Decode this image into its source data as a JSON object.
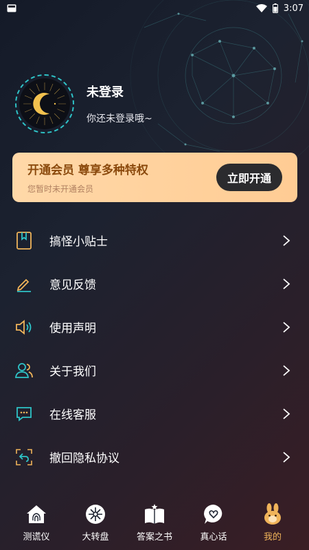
{
  "status_bar": {
    "time": "3:07"
  },
  "profile": {
    "name": "未登录",
    "subtitle": "你还未登录哦~"
  },
  "vip": {
    "title": "开通会员 尊享多种特权",
    "subtitle": "您暂时未开通会员",
    "button": "立即开通"
  },
  "menu": [
    {
      "label": "搞怪小贴士",
      "icon": "bookmark-icon"
    },
    {
      "label": "意见反馈",
      "icon": "pencil-icon"
    },
    {
      "label": "使用声明",
      "icon": "speaker-icon"
    },
    {
      "label": "关于我们",
      "icon": "users-icon"
    },
    {
      "label": "在线客服",
      "icon": "chat-icon"
    },
    {
      "label": "撤回隐私协议",
      "icon": "undo-icon"
    }
  ],
  "tabs": [
    {
      "label": "测谎仪",
      "icon": "fingerprint-house-icon",
      "active": false
    },
    {
      "label": "大转盘",
      "icon": "wheel-icon",
      "active": false
    },
    {
      "label": "答案之书",
      "icon": "book-icon",
      "active": false
    },
    {
      "label": "真心话",
      "icon": "heart-bubble-icon",
      "active": false
    },
    {
      "label": "我的",
      "icon": "bunny-icon",
      "active": true
    }
  ],
  "colors": {
    "accent": "#2ec4c8",
    "vip_bg": "#ffd8a8",
    "vip_text": "#8b4a0d",
    "active_tab": "#f0b45a"
  }
}
